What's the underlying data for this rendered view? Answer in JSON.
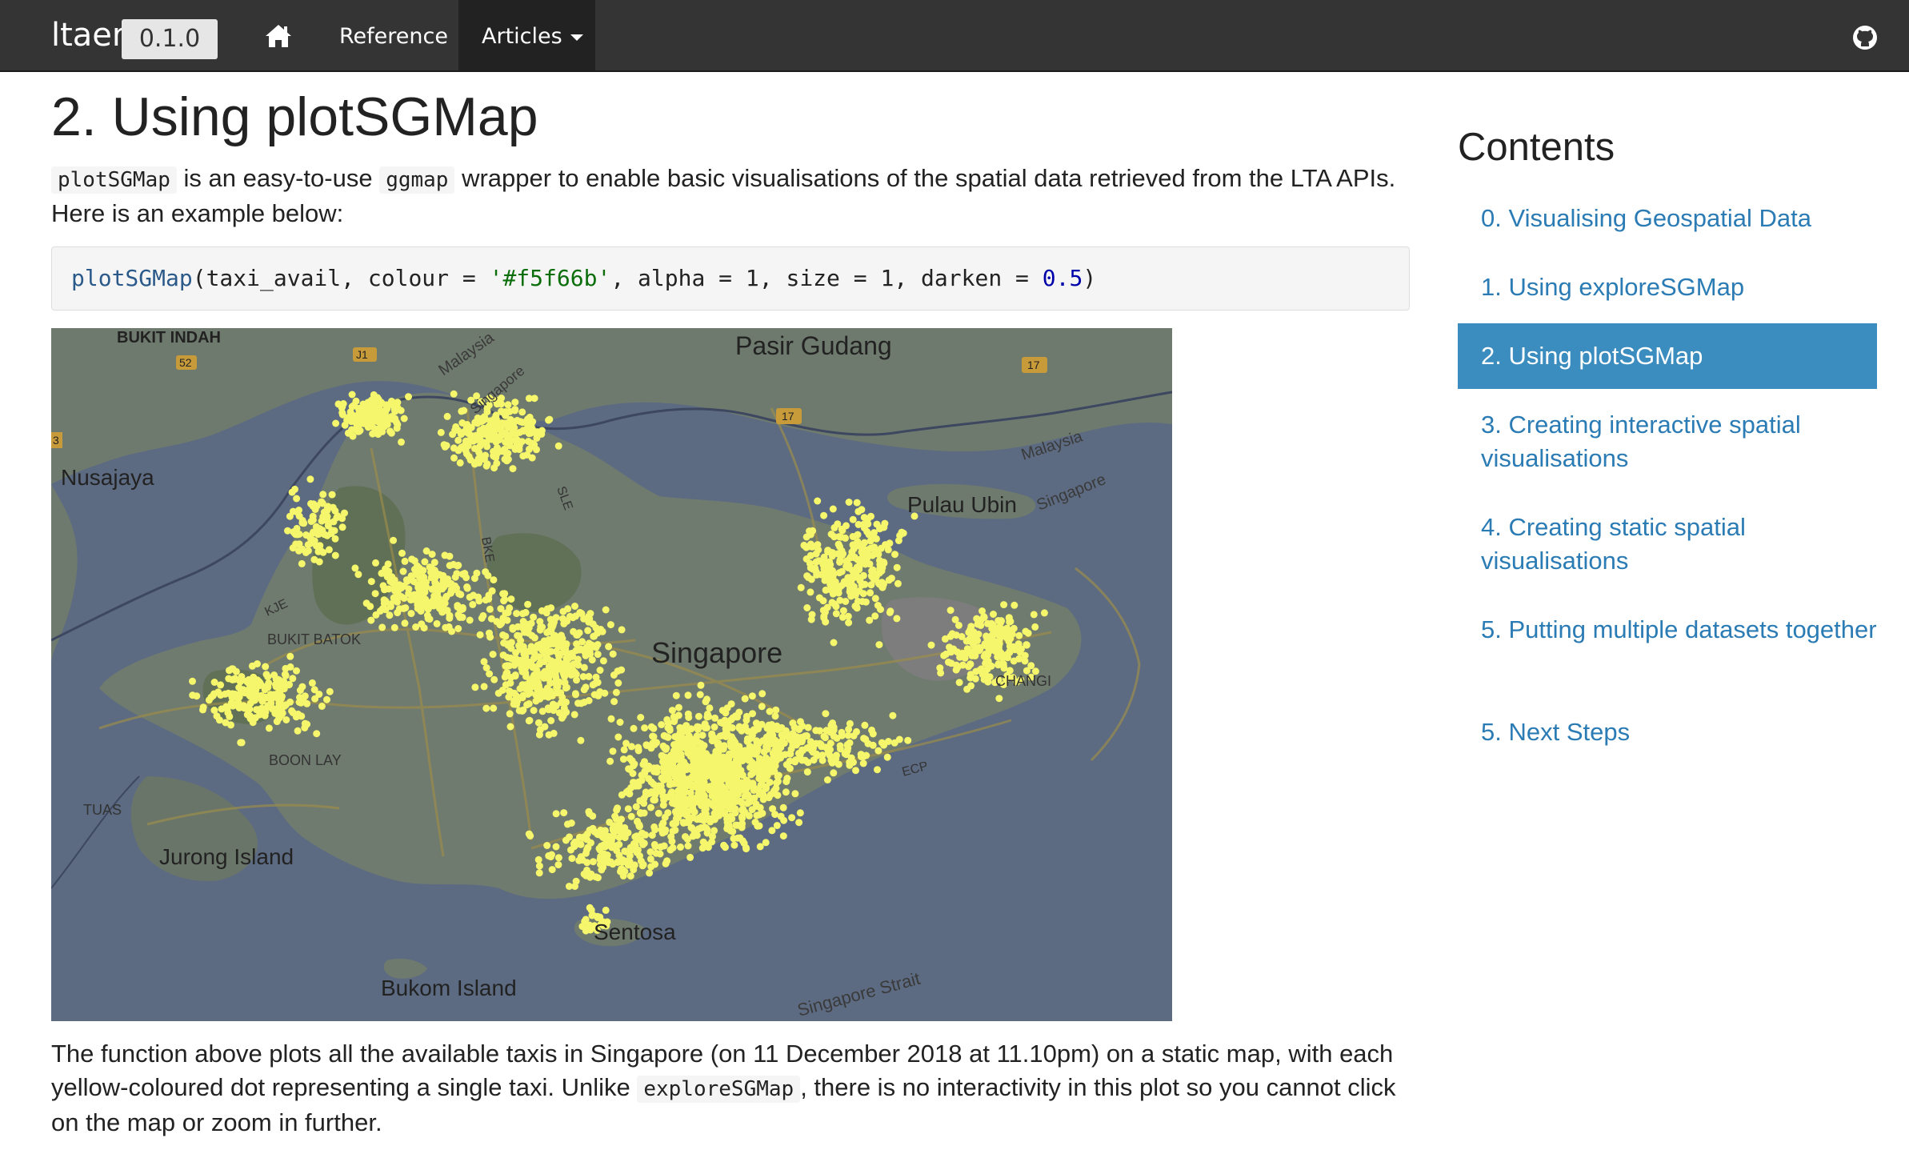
{
  "navbar": {
    "brand": "ltaer",
    "version": "0.1.0",
    "home_icon": "home-icon",
    "reference_label": "Reference",
    "articles_label": "Articles",
    "github_icon": "github-icon",
    "bg_color": "#343434"
  },
  "main": {
    "title": "2. Using plotSGMap",
    "para1": {
      "code1": "plotSGMap",
      "text1": " is an easy-to-use ",
      "code2": "ggmap",
      "text2": " wrapper to enable basic visualisations of the spatial data retrieved from the LTA APIs. Here is an example below:"
    },
    "code": {
      "fn": "plotSGMap",
      "args1": "(taxi_avail, colour = ",
      "str": "'#f5f66b'",
      "args2": ", alpha = 1, size = 1, darken = ",
      "num": "0.5",
      "close": ")"
    },
    "map": {
      "labels": {
        "bukit_indah": "BUKIT INDAH",
        "pasir_gudang": "Pasir Gudang",
        "nusajaya": "Nusajaya",
        "malaysia1": "Malaysia",
        "malaysia2": "Malaysia",
        "singapore1": "Singapore",
        "singapore2": "Singapore",
        "pulau_ubin": "Pulau Ubin",
        "jurong_island": "Jurong Island",
        "tuas": "TUAS",
        "bukom_island": "Bukom Island",
        "sentosa": "Sentosa",
        "singapore_strait": "Singapore Strait",
        "singapore_center": "Singapore",
        "changi": "CHANGI",
        "boon_lay": "BOON LAY",
        "bukit_batok": "BUKIT BATOK",
        "kje": "KJE",
        "bke": "BKE",
        "sle": "SLE",
        "ecp": "ECP",
        "road_52": "52",
        "road_j1": "J1",
        "road_17a": "17",
        "road_17b": "17",
        "road_3": "3"
      },
      "dot_color": "#f5f66b",
      "land_color": "#6f7a6e",
      "water_color": "#5b6b83"
    },
    "para2": {
      "text1": "The function above plots all the available taxis in Singapore (on 11 December 2018 at 11.10pm) on a static map, with each yellow-coloured dot representing a single taxi. Unlike ",
      "code": "exploreSGMap",
      "text2": ", there is no interactivity in this plot so you cannot click on the map or zoom in further."
    }
  },
  "sidebar": {
    "title": "Contents",
    "items": [
      {
        "label": "0. Visualising Geospatial Data"
      },
      {
        "label": "1. Using exploreSGMap"
      },
      {
        "label": "2. Using plotSGMap"
      },
      {
        "label": "3. Creating interactive spatial visualisations"
      },
      {
        "label": "4. Creating static spatial visualisations"
      },
      {
        "label": "5. Putting multiple datasets together"
      },
      {
        "label": "5. Next Steps"
      }
    ],
    "active_color": "#3c8dbf",
    "link_color": "#2b7bb4"
  }
}
